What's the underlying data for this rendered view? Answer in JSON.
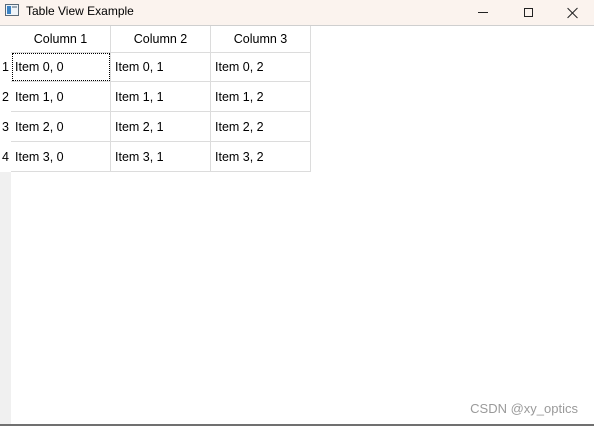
{
  "window": {
    "title": "Table View Example",
    "icon": "table-window-icon",
    "controls": {
      "minimize": "minimize-icon",
      "maximize": "maximize-icon",
      "close": "close-icon"
    }
  },
  "table": {
    "columns": [
      "Column 1",
      "Column 2",
      "Column 3"
    ],
    "row_headers": [
      "1",
      "2",
      "3",
      "4"
    ],
    "rows": [
      [
        "Item 0, 0",
        "Item 0, 1",
        "Item 0, 2"
      ],
      [
        "Item 1, 0",
        "Item 1, 1",
        "Item 1, 2"
      ],
      [
        "Item 2, 0",
        "Item 2, 1",
        "Item 2, 2"
      ],
      [
        "Item 3, 0",
        "Item 3, 1",
        "Item 3, 2"
      ]
    ],
    "focused_cell": "Item 0, 0"
  },
  "watermark": "CSDN @xy_optics"
}
